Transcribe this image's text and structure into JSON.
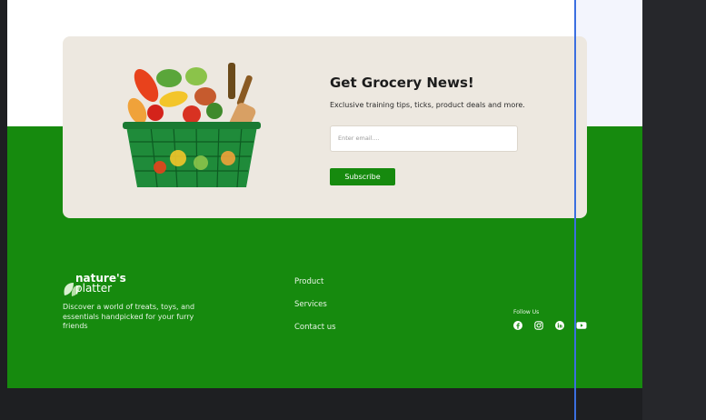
{
  "newsletter": {
    "title": "Get Grocery News!",
    "subtitle": "Exclusive training tips, ticks, product deals and more.",
    "email_placeholder": "Enter email....",
    "subscribe_label": "Subscribe"
  },
  "footer": {
    "brand_line1": "nature's",
    "brand_line2": "platter",
    "description": "Discover a world of treats, toys, and essentials handpicked for your furry friends",
    "links": [
      "Product",
      "Services",
      "Contact us"
    ],
    "follow_label": "Follow Us",
    "social_icons": [
      "facebook-icon",
      "instagram-icon",
      "linkedin-icon",
      "youtube-icon"
    ]
  },
  "colors": {
    "brand_green": "#168a0e",
    "card_bg": "#ede8e0",
    "guide_blue": "#3b6fe0"
  }
}
